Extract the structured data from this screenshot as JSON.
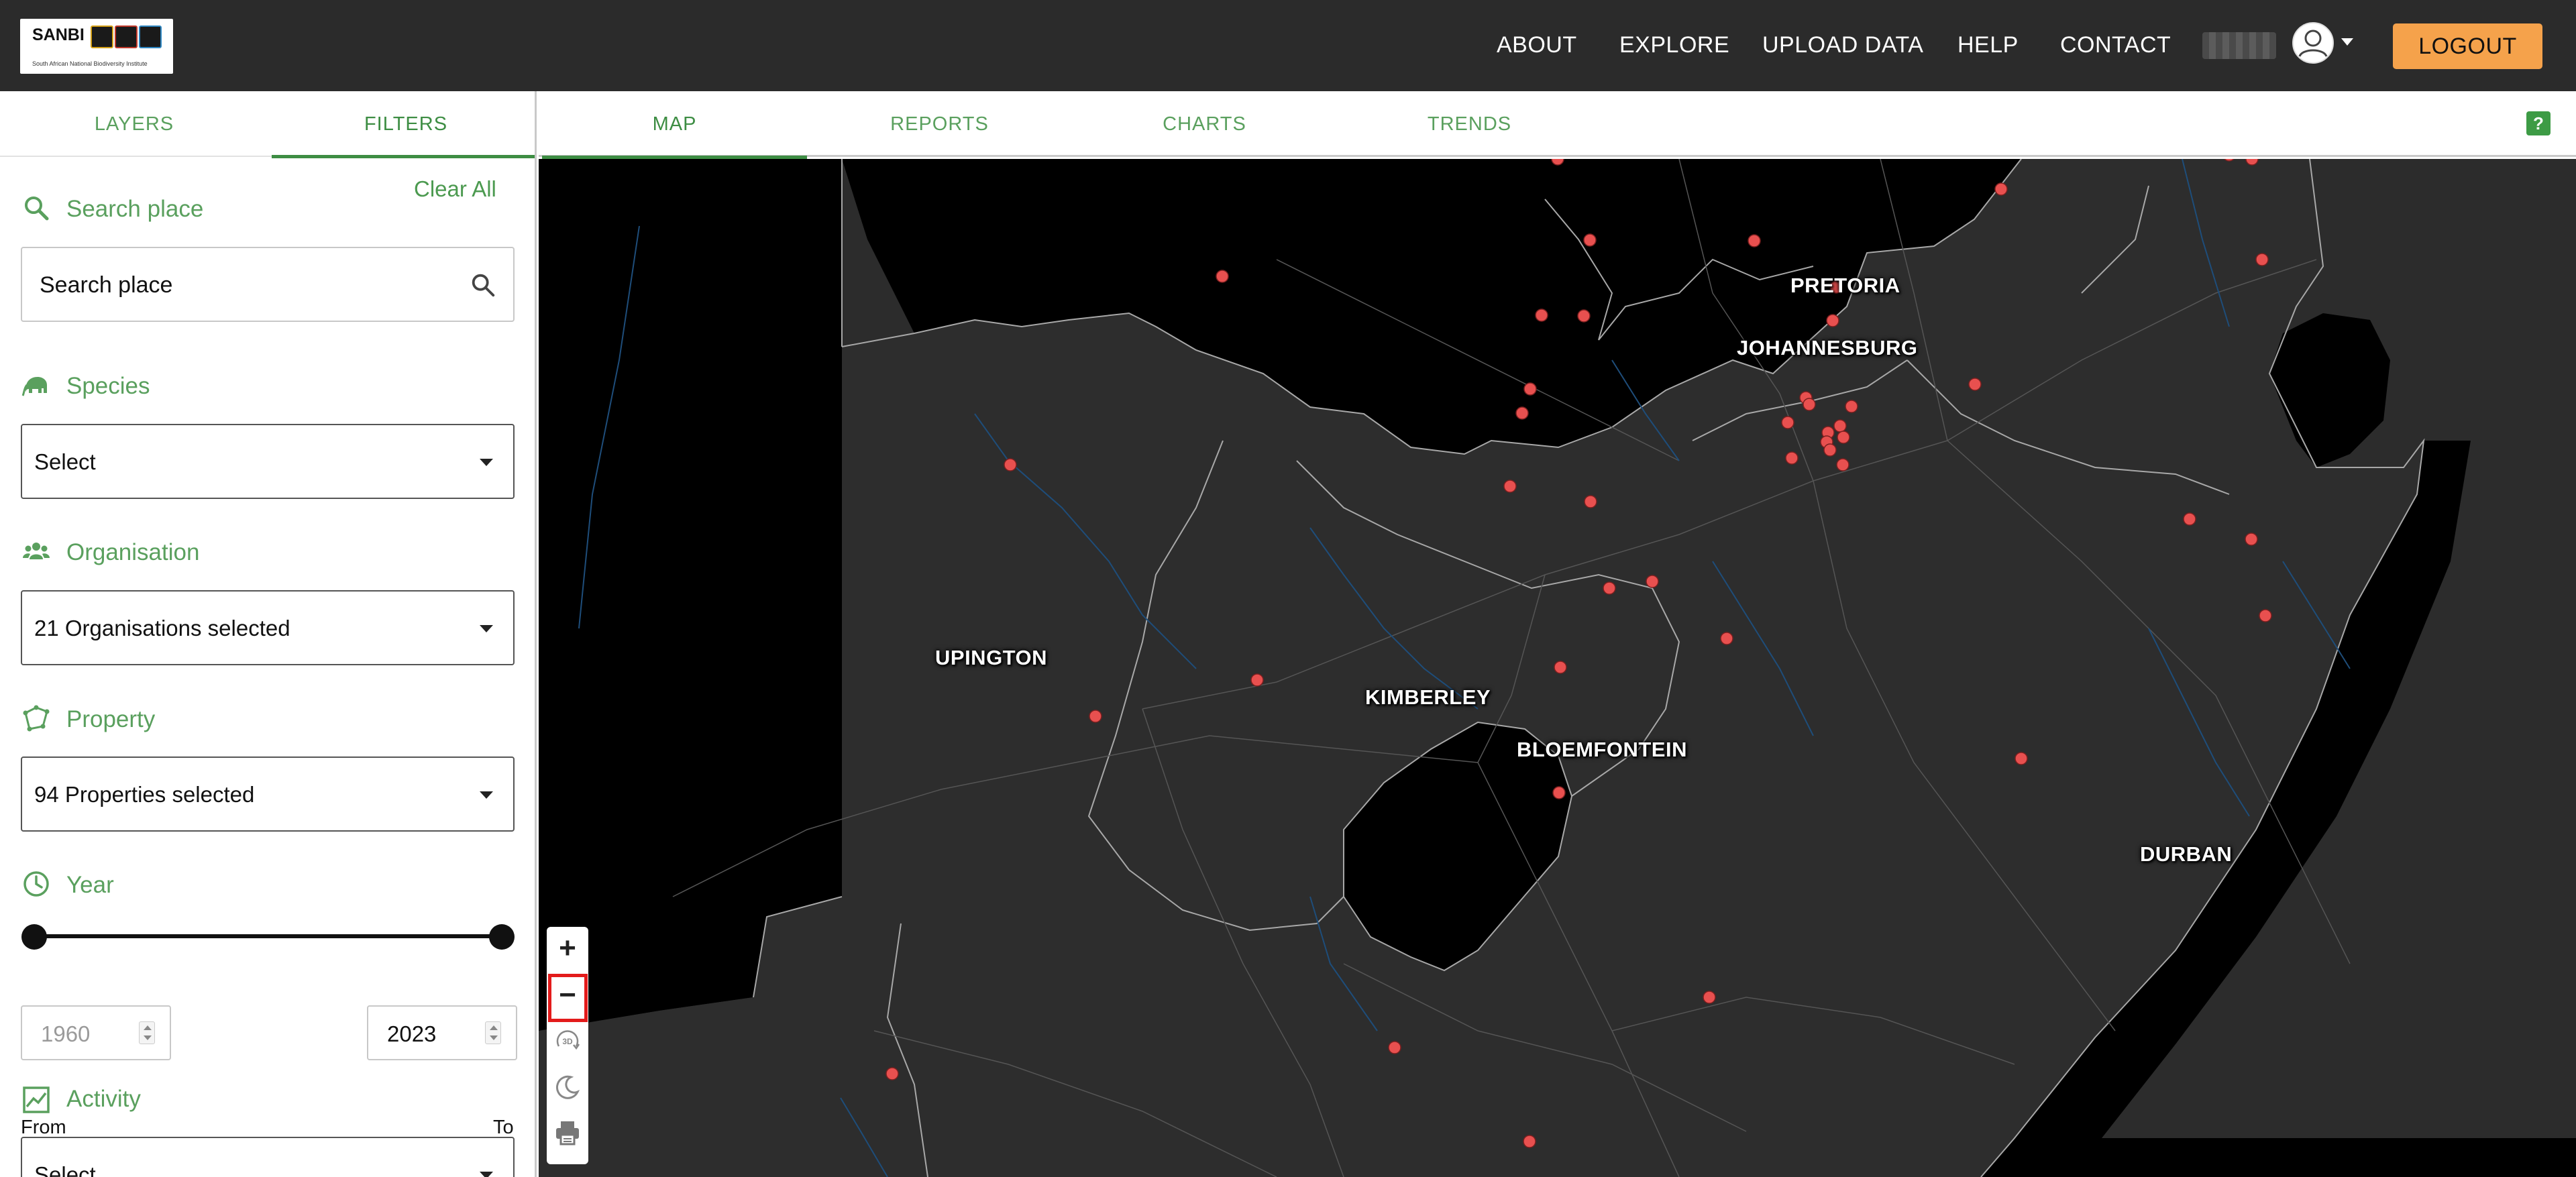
{
  "header": {
    "logo_text": "SANBI",
    "logo_subtitle": "South African National Biodiversity Institute",
    "nav": [
      "ABOUT",
      "EXPLORE",
      "UPLOAD DATA",
      "HELP",
      "CONTACT"
    ],
    "logout_label": "LOGOUT",
    "accent_color": "#f5a24b"
  },
  "left_tabs": [
    "LAYERS",
    "FILTERS"
  ],
  "active_left_tab": "FILTERS",
  "filters": {
    "clear_all": "Clear All",
    "search": {
      "label": "Search place",
      "placeholder": "Search place"
    },
    "species": {
      "label": "Species",
      "value": "Select"
    },
    "organisation": {
      "label": "Organisation",
      "value": "21 Organisations selected"
    },
    "property": {
      "label": "Property",
      "value": "94 Properties selected"
    },
    "year": {
      "label": "Year",
      "from_value": "1960",
      "to_value": "2023",
      "from_label": "From",
      "to_label": "To"
    },
    "activity": {
      "label": "Activity",
      "value": "Select"
    }
  },
  "content_tabs": [
    "MAP",
    "REPORTS",
    "CHARTS",
    "TRENDS"
  ],
  "active_content_tab": "MAP",
  "help_label": "?",
  "map": {
    "cities": [
      "PRETORIA",
      "JOHANNESBURG",
      "UPINGTON",
      "KIMBERLEY",
      "BLOEMFONTEIN",
      "DURBAN"
    ],
    "point_color": "#e8504f",
    "controls": {
      "zoom_in": "+",
      "zoom_out": "−",
      "three_d": "3D"
    }
  }
}
